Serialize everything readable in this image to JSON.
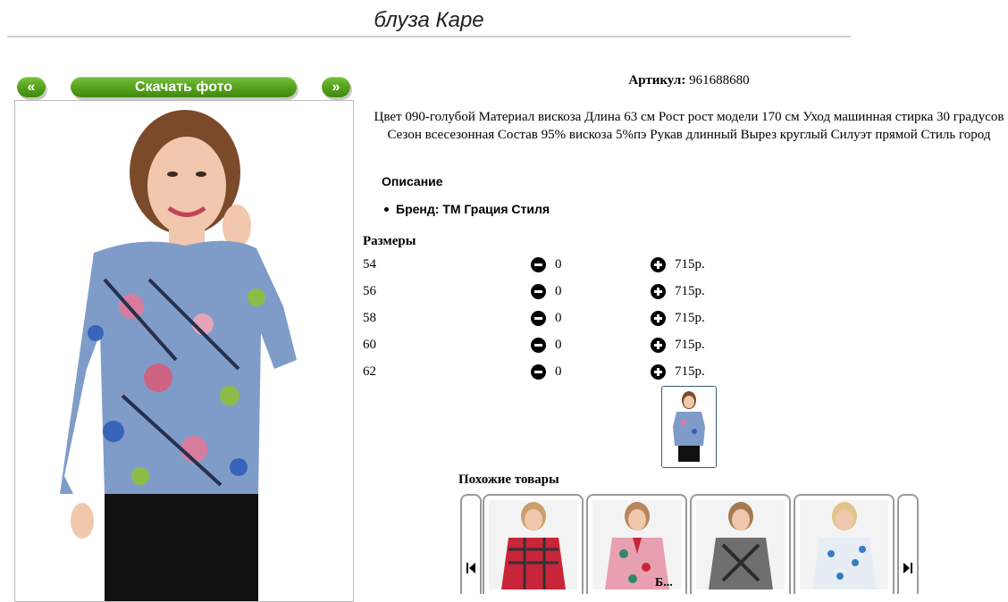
{
  "product": {
    "title": "блуза Каре",
    "article_label": "Артикул:",
    "article_value": "961688680",
    "description": "Цвет 090-голубой Материал вискоза Длина 63 см Рост рост модели 170 см Уход машинная стирка 30 градусов Сезон всесезонная Состав 95% вискоза 5%пэ Рукав длинный Вырез круглый Силуэт прямой Стиль город",
    "desc_heading": "Описание",
    "brand": "Бренд: ТМ Грация Стиля"
  },
  "gallery": {
    "prev_label": "«",
    "next_label": "»",
    "download_label": "Скачать фото"
  },
  "sizes": {
    "heading": "Размеры",
    "rows": [
      {
        "size": "54",
        "qty": "0",
        "price": "715р."
      },
      {
        "size": "56",
        "qty": "0",
        "price": "715р."
      },
      {
        "size": "58",
        "qty": "0",
        "price": "715р."
      },
      {
        "size": "60",
        "qty": "0",
        "price": "715р."
      },
      {
        "size": "62",
        "qty": "0",
        "price": "715р."
      }
    ]
  },
  "similar": {
    "heading": "Похожие товары",
    "cut_text": "Б..."
  },
  "colors": {
    "button_green": "#5aa41f",
    "thumb_border": "#355a7a"
  }
}
